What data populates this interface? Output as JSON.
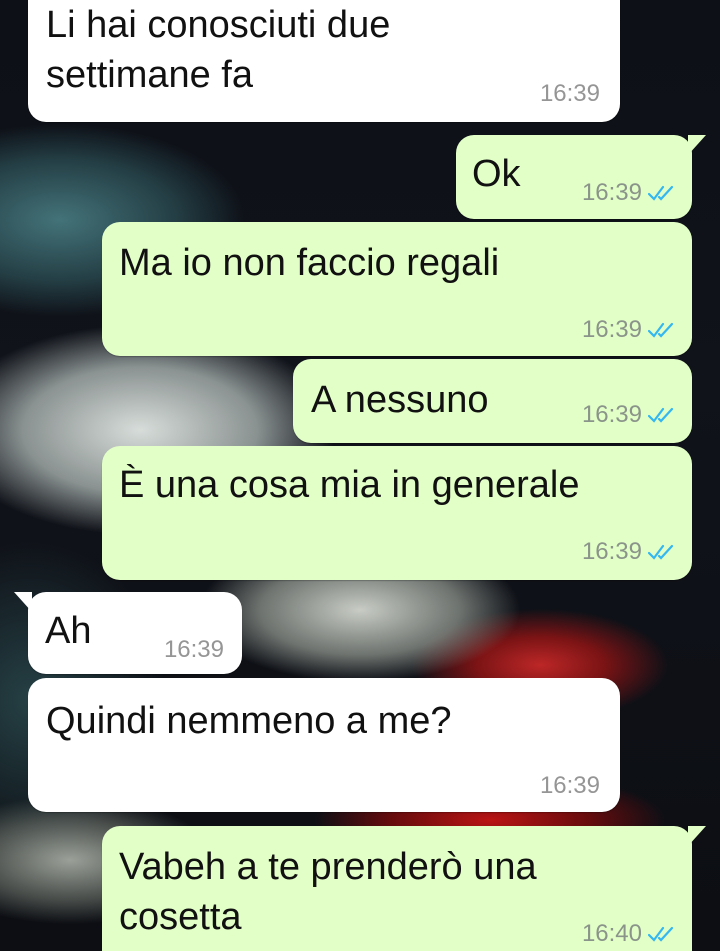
{
  "colors": {
    "incoming_bubble": "#ffffff",
    "outgoing_bubble": "#e2ffc7",
    "read_ticks": "#34b7f1"
  },
  "messages": [
    {
      "direction": "incoming",
      "text": "Li hai conosciuti due\nsettimane fa",
      "time": "16:39"
    },
    {
      "direction": "outgoing",
      "text": "Ok",
      "time": "16:39",
      "status": "read-double-check-icon"
    },
    {
      "direction": "outgoing",
      "text": "Ma io non faccio regali",
      "time": "16:39",
      "status": "read-double-check-icon"
    },
    {
      "direction": "outgoing",
      "text": "A nessuno",
      "time": "16:39",
      "status": "read-double-check-icon"
    },
    {
      "direction": "outgoing",
      "text": "È una cosa mia in generale",
      "time": "16:39",
      "status": "read-double-check-icon"
    },
    {
      "direction": "incoming",
      "text": "Ah",
      "time": "16:39"
    },
    {
      "direction": "incoming",
      "text": "Quindi nemmeno a me?",
      "time": "16:39"
    },
    {
      "direction": "outgoing",
      "text": "Vabeh a te prenderò una\ncosetta",
      "time": "16:40",
      "status": "read-double-check-icon"
    }
  ]
}
